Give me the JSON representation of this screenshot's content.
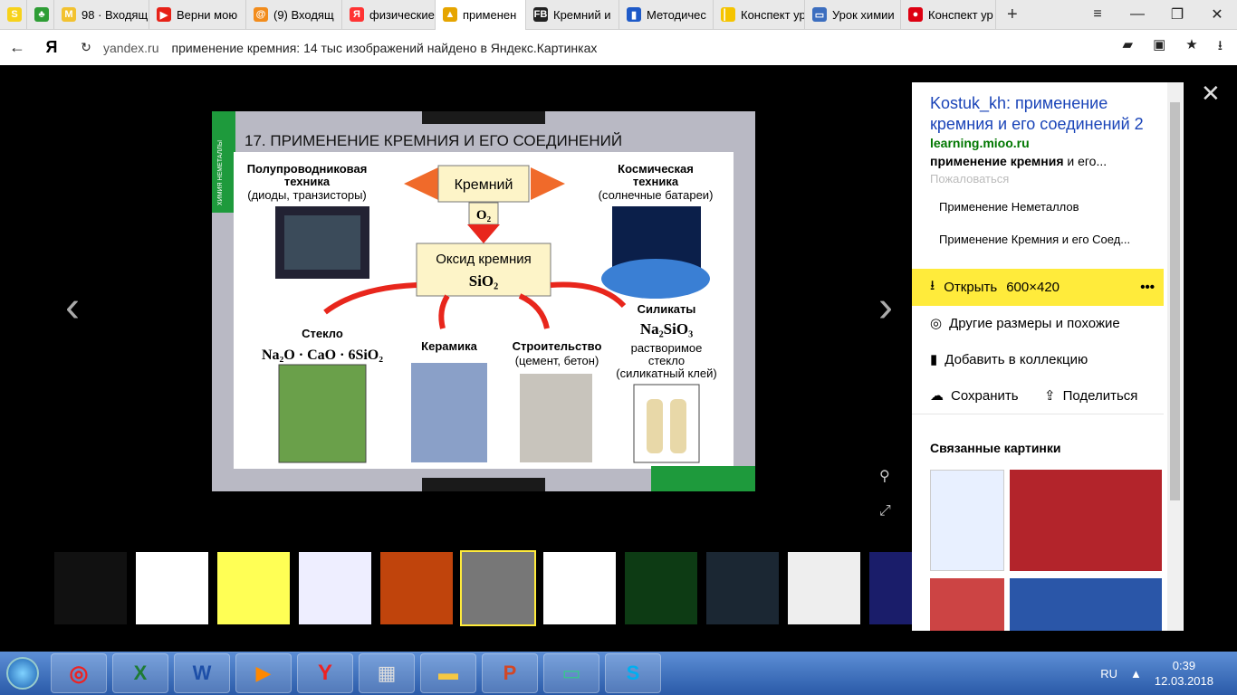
{
  "tabs": [
    {
      "label": "",
      "fav": "yandex-s",
      "color": "#f7d21b",
      "glyph": "S"
    },
    {
      "label": "",
      "fav": "clover",
      "color": "#2e9d35",
      "glyph": "♣"
    },
    {
      "label": "98 · Входящ",
      "fav": "mail",
      "color": "#f2c230",
      "glyph": "M"
    },
    {
      "label": "Верни мою",
      "fav": "youtube",
      "color": "#e62117",
      "glyph": "▶"
    },
    {
      "label": "(9) Входящ",
      "fav": "mailru",
      "color": "#f28c1c",
      "glyph": "@"
    },
    {
      "label": "физические",
      "fav": "yandex",
      "color": "#f33",
      "glyph": "Я"
    },
    {
      "label": "применен",
      "fav": "images",
      "color": "#e6a500",
      "glyph": "▲",
      "active": true
    },
    {
      "label": "Кремний и",
      "fav": "fb",
      "color": "#222",
      "glyph": "FB"
    },
    {
      "label": "Методичес",
      "fav": "book",
      "color": "#1e5ac8",
      "glyph": "▮"
    },
    {
      "label": "Конспект ур",
      "fav": "pencil",
      "color": "#f5c400",
      "glyph": "▏"
    },
    {
      "label": "Урок химии",
      "fav": "board",
      "color": "#3c6ebf",
      "glyph": "▭"
    },
    {
      "label": "Конспект ур",
      "fav": "video",
      "color": "#d01",
      "glyph": "●"
    }
  ],
  "addressbar": {
    "domain": "yandex.ru",
    "title": "применение кремния: 14 тыс изображений найдено в Яндекс.Картинках",
    "yandex_logo": "Я"
  },
  "slide": {
    "header": "17. ПРИМЕНЕНИЕ КРЕМНИЯ И ЕГО СОЕДИНЕНИЙ",
    "side_label": "ХИМИЯ НЕМЕТАЛЛЫ",
    "semi_l1": "Полупроводниковая",
    "semi_l2": "техника",
    "semi_l3": "(диоды, транзисторы)",
    "silicon": "Кремний",
    "oxygen": "O₂",
    "space_l1": "Космическая",
    "space_l2": "техника",
    "space_l3": "(солнечные батареи)",
    "oxide_l1": "Оксид кремния",
    "oxide_l2": "SiO₂",
    "glass": "Стекло",
    "glass_formula": "Na₂O · CaO · 6SiO₂",
    "ceramics": "Керамика",
    "build_l1": "Строительство",
    "build_l2": "(цемент, бетон)",
    "silicates": "Силикаты",
    "silicates_formula": "Na₂SiO₃",
    "sil_l1": "растворимое",
    "sil_l2": "стекло",
    "sil_l3": "(силикатный клей)"
  },
  "panel": {
    "title": "Kostuk_kh: применение кремния и его соединений 2",
    "domain": "learning.mioo.ru",
    "desc_bold": "применение кремния",
    "desc_rest": " и его...",
    "complain": "Пожаловаться",
    "link1": "Применение Неметаллов",
    "link2": "Применение Кремния и его Соед...",
    "open_label": "Открыть",
    "open_size": "600×420",
    "more": "•••",
    "other_sizes": "Другие размеры и похожие",
    "add_collection": "Добавить в коллекцию",
    "save": "Сохранить",
    "share": "Поделиться",
    "related": "Связанные картинки"
  },
  "taskbar": {
    "lang": "RU",
    "time": "0:39",
    "date": "12.03.2018"
  },
  "colors": {
    "accent_yellow": "#ffeb3b",
    "link_blue": "#1a44b8",
    "domain_green": "#007700"
  }
}
